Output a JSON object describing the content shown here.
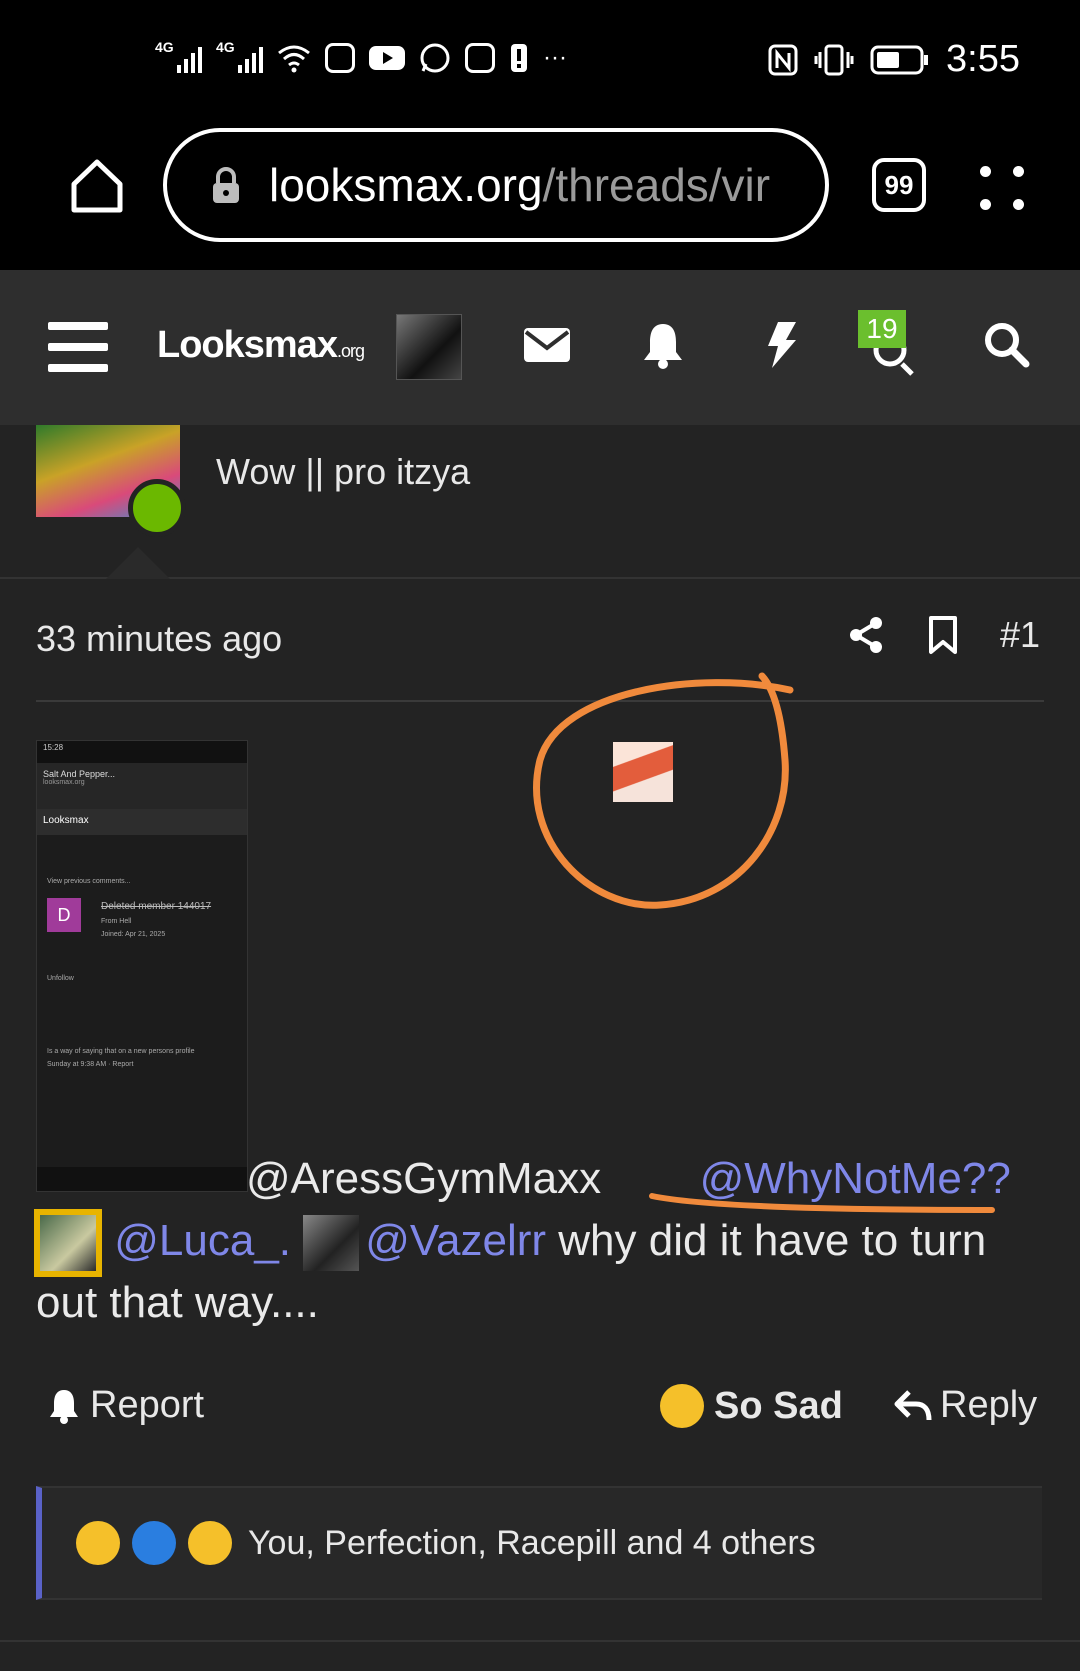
{
  "status_bar": {
    "network_1": "4G",
    "network_2": "4G",
    "overflow": "···",
    "time": "3:55",
    "icons": [
      "signal-icon",
      "signal-icon",
      "wifi-icon",
      "instagram-icon",
      "youtube-icon",
      "whatsapp-icon",
      "instagram-icon",
      "alert-icon",
      "nfc-icon",
      "vibrate-icon",
      "battery-icon"
    ]
  },
  "browser": {
    "url_domain": "looksmax.org",
    "url_path": "/threads/vir",
    "tab_count": "99"
  },
  "site_header": {
    "logo_text": "Looksmax",
    "logo_suffix": ".org",
    "notification_badge": "19"
  },
  "profile": {
    "user_title": "Wow || pro itzya"
  },
  "post": {
    "time": "33 minutes ago",
    "post_number": "#1",
    "mention_1": "@AressGymMaxx",
    "mention_2": "@WhyNotMe??",
    "mention_3": "@Luca_.",
    "mention_4": "@Vazelrr",
    "body_text": " why did it have to turn out that way....",
    "report_label": "Report",
    "reaction_label": "So Sad",
    "reply_label": "Reply",
    "reactions_summary": "You, Perfection, Racepill and 4 others"
  },
  "embedded_screenshot": {
    "status": "15:28",
    "title": "Salt And Pepper...",
    "subtitle": "looksmax.org",
    "nav": "Looksmax",
    "line_1": "View previous comments...",
    "deleted_member": "Deleted member 144017",
    "from": "From Hell",
    "joined": "Joined: Apr 21, 2025",
    "unfollow": "Unfollow",
    "reply_text": "Is a way of saying that on a new persons profile",
    "timestamp": "Sunday at 9:38 AM",
    "report": "Report"
  },
  "colors": {
    "accent_mention": "#7f87e8",
    "online": "#6bb800",
    "badge": "#6bbf2e",
    "annotation": "#f08a3c",
    "reaction_border": "#5a62c8"
  }
}
